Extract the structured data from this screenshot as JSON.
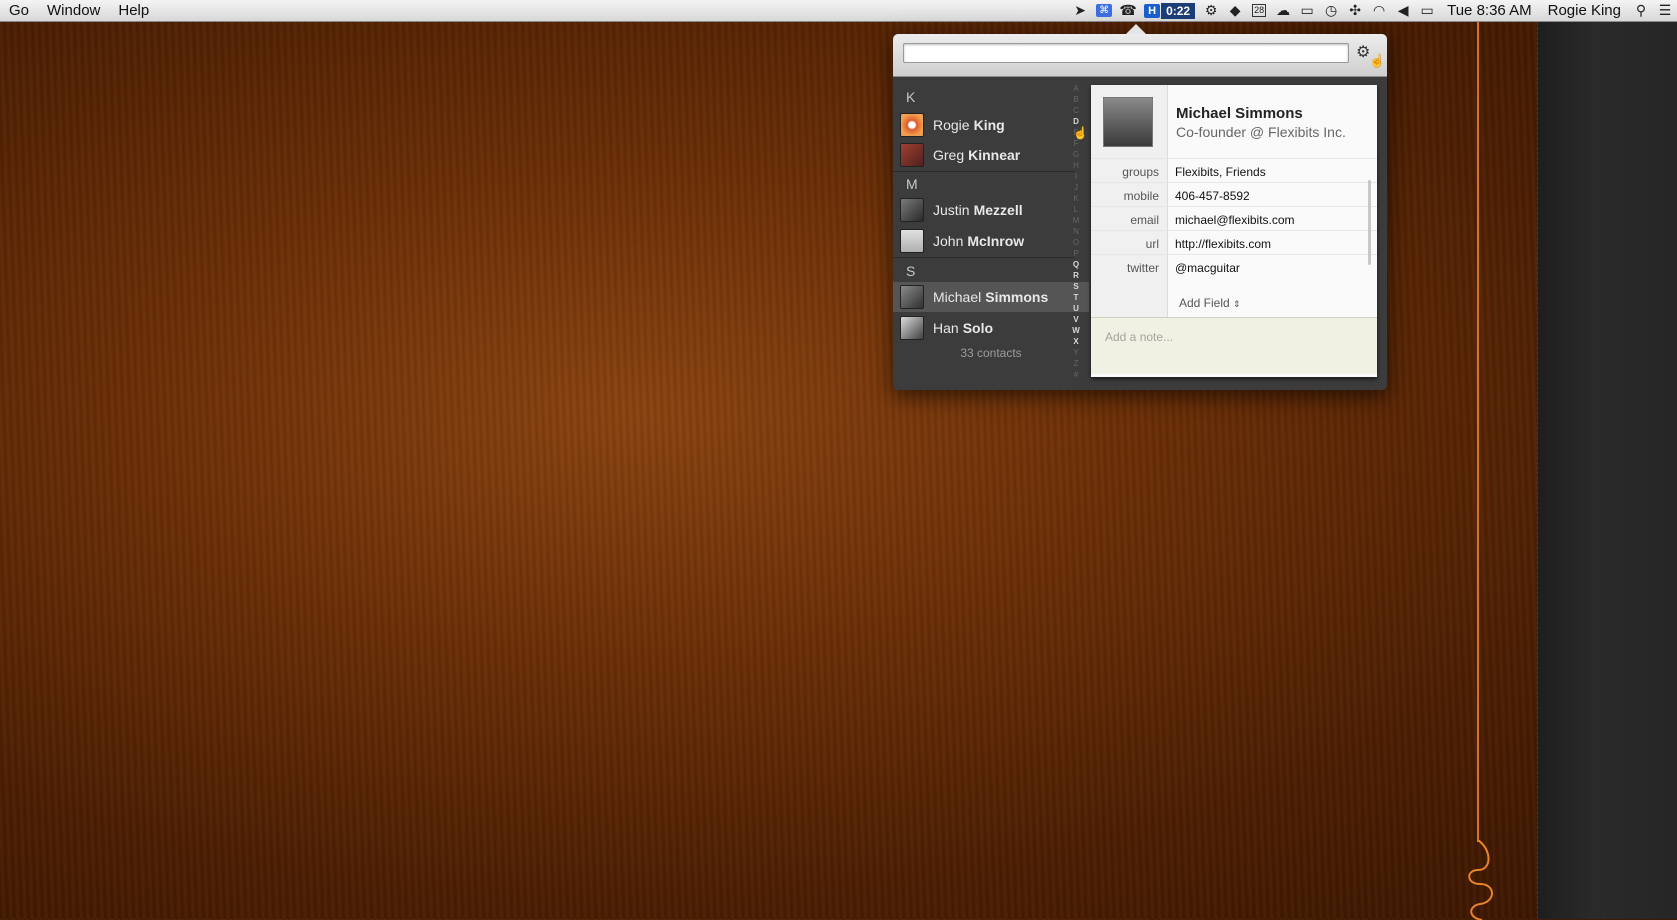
{
  "menubar": {
    "left_items": [
      "Go",
      "Window",
      "Help"
    ],
    "timer": "0:22",
    "h_badge": "H",
    "calendar_day": "28",
    "clock": "Tue 8:36 AM",
    "user": "Rogie King"
  },
  "popover": {
    "search_value": "",
    "sections": [
      {
        "letter": "K",
        "contacts": [
          {
            "first": "Rogie",
            "last": "King"
          },
          {
            "first": "Greg",
            "last": "Kinnear"
          }
        ]
      },
      {
        "letter": "M",
        "contacts": [
          {
            "first": "Justin",
            "last": "Mezzell"
          },
          {
            "first": "John",
            "last": "McInrow"
          }
        ]
      },
      {
        "letter": "S",
        "contacts": [
          {
            "first": "Michael",
            "last": "Simmons",
            "selected": true
          },
          {
            "first": "Han",
            "last": "Solo"
          }
        ]
      }
    ],
    "contact_count": "33 contacts",
    "alpha_index": [
      "A",
      "B",
      "C",
      "D",
      "E",
      "F",
      "G",
      "H",
      "I",
      "J",
      "K",
      "L",
      "M",
      "N",
      "O",
      "P",
      "Q",
      "R",
      "S",
      "T",
      "U",
      "V",
      "W",
      "X",
      "Y",
      "Z",
      "#"
    ],
    "alpha_active": [
      "D",
      "Q",
      "R",
      "S",
      "T",
      "U",
      "V",
      "W",
      "X"
    ]
  },
  "card": {
    "name": "Michael Simmons",
    "subtitle": "Co-founder @ Flexibits Inc.",
    "fields": [
      {
        "label": "groups",
        "value": "Flexibits, Friends"
      },
      {
        "label": "mobile",
        "value": "406-457-8592"
      },
      {
        "label": "email",
        "value": "michael@flexibits.com"
      },
      {
        "label": "url",
        "value": "http://flexibits.com"
      },
      {
        "label": "twitter",
        "value": "@macguitar"
      }
    ],
    "add_field_label": "Add Field",
    "note_placeholder": "Add a note..."
  }
}
